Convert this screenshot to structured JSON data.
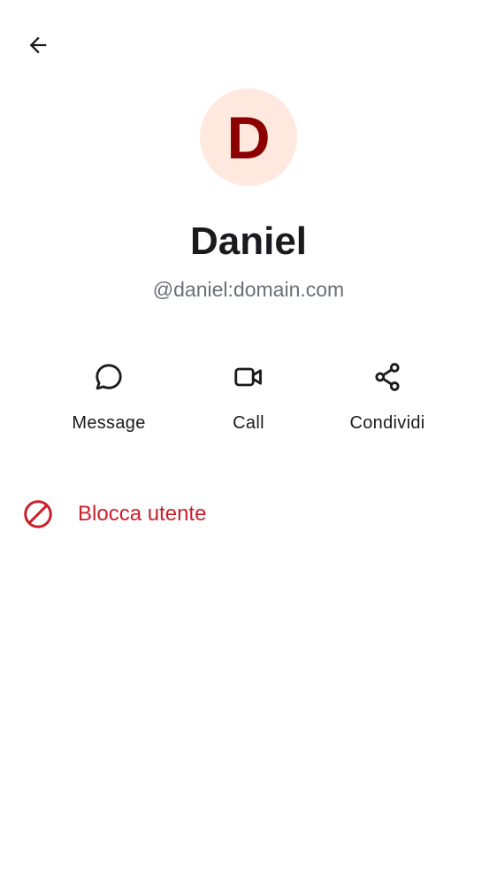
{
  "header": {
    "back_icon": "arrow-left-icon"
  },
  "profile": {
    "avatar_letter": "D",
    "avatar_bg_color": "#ffe9df",
    "avatar_letter_color": "#8b0000",
    "display_name": "Daniel",
    "user_id": "@daniel:domain.com"
  },
  "actions": [
    {
      "label": "Message",
      "icon": "message-bubble-icon"
    },
    {
      "label": "Call",
      "icon": "video-camera-icon"
    },
    {
      "label": "Condividi",
      "icon": "share-icon"
    }
  ],
  "danger": {
    "block_label": "Blocca utente",
    "block_icon": "block-icon",
    "color": "#cc1f2a"
  }
}
